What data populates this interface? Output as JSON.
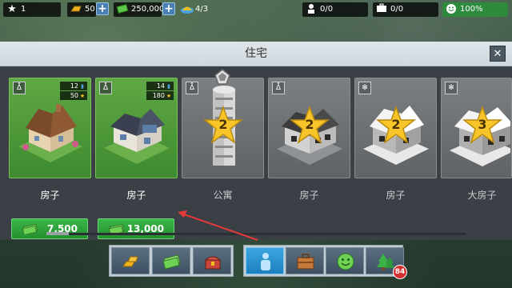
{
  "hud": {
    "level": "1",
    "gold": "50",
    "cash": "250,000",
    "builders": "4/3",
    "workers": "0/0",
    "briefcase": "0/0",
    "happiness": "100%"
  },
  "panel": {
    "title": "住宅",
    "close_symbol": "✕"
  },
  "cards": [
    {
      "label": "房子",
      "locked": false,
      "pop": "12",
      "xp": "50",
      "price": "7,500",
      "type_icon": "grass-icon"
    },
    {
      "label": "房子",
      "locked": false,
      "pop": "14",
      "xp": "180",
      "price": "13,000",
      "type_icon": "grass-icon"
    },
    {
      "label": "公寓",
      "locked": true,
      "required_level": "2",
      "type_icon": "grass-icon"
    },
    {
      "label": "房子",
      "locked": true,
      "required_level": "2",
      "type_icon": "grass-icon"
    },
    {
      "label": "房子",
      "locked": true,
      "required_level": "2",
      "type_icon": "snowflake-icon"
    },
    {
      "label": "大房子",
      "locked": true,
      "required_level": "3",
      "type_icon": "snowflake-icon"
    }
  ],
  "tabs": [
    {
      "name": "gold-bars-icon"
    },
    {
      "name": "cash-icon"
    },
    {
      "name": "treasure-chest-icon"
    },
    {
      "name": "person-icon",
      "selected": true
    },
    {
      "name": "briefcase-icon"
    },
    {
      "name": "smiley-icon"
    },
    {
      "name": "tree-icon"
    }
  ],
  "tree_badge": "84",
  "colors": {
    "accent_green": "#3cb548",
    "selected_tab": "#3aa6e0",
    "star": "#f7c52a",
    "arrow": "#e23a3a"
  }
}
